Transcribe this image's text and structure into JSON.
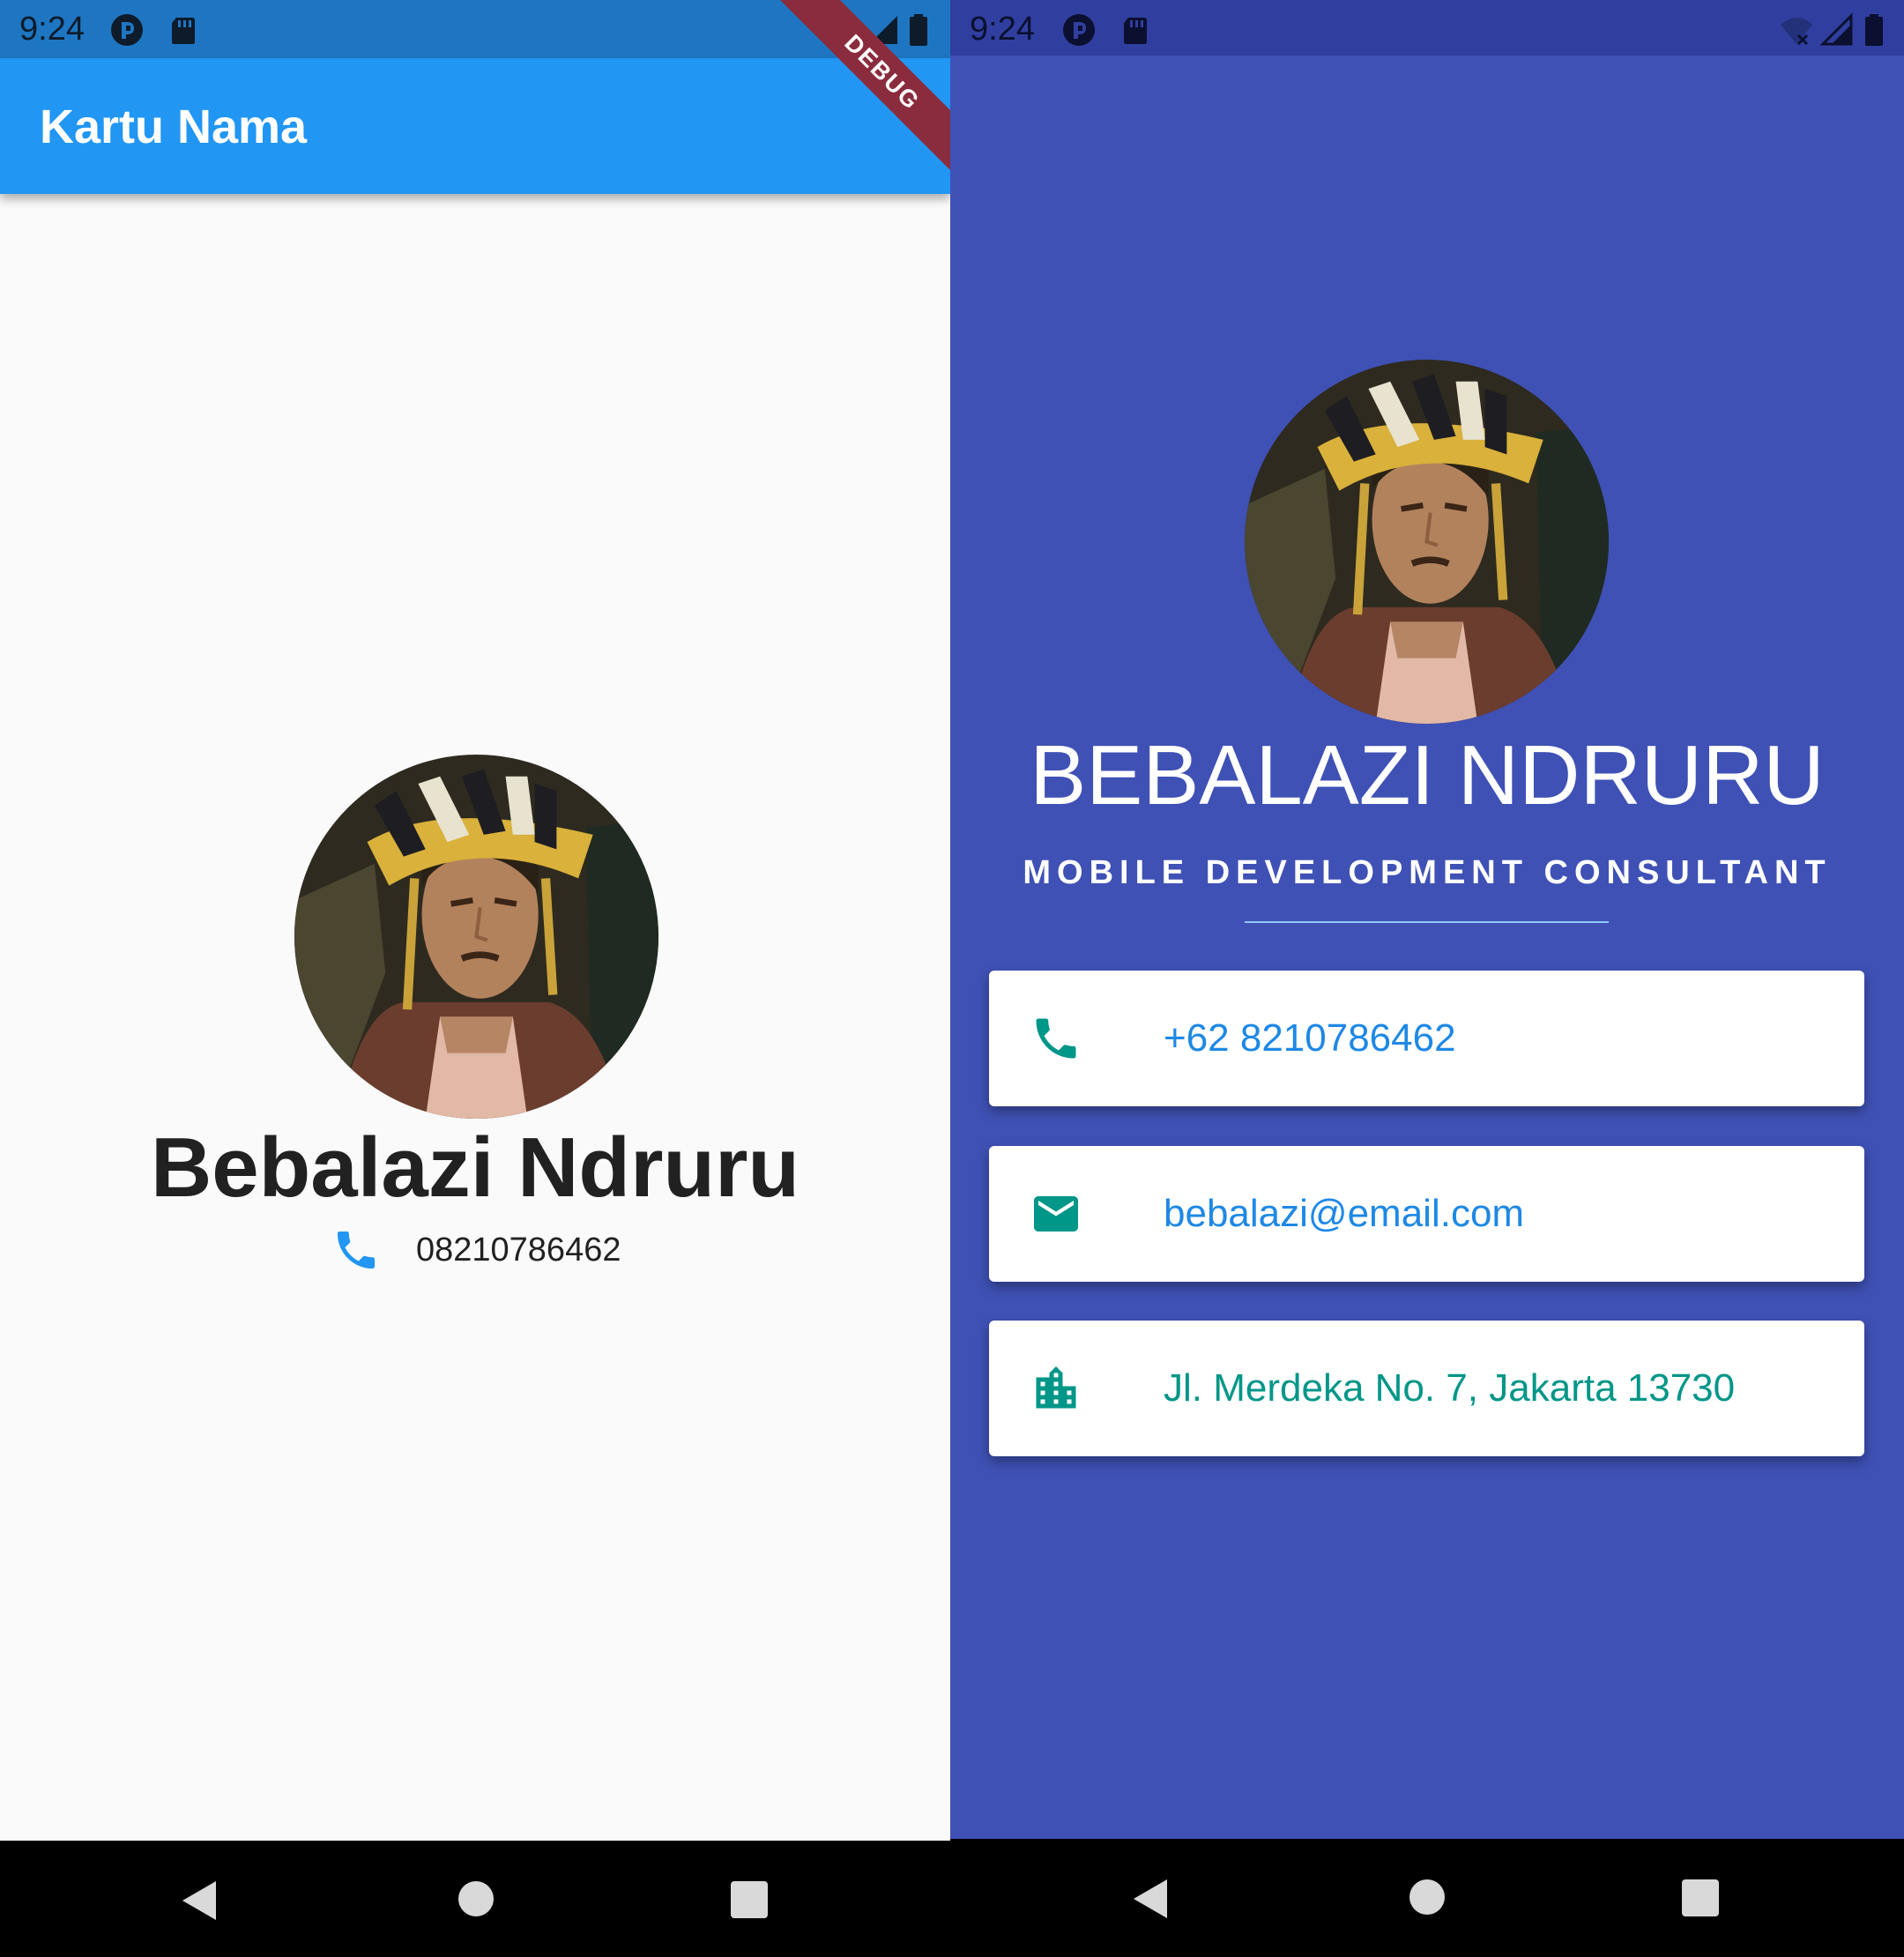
{
  "left_screen": {
    "status_bar": {
      "time": "9:24",
      "background": "#1E76C2",
      "color": "#0d1b2a"
    },
    "app_bar": {
      "title": "Kartu Nama",
      "color": "#2196F3"
    },
    "debug_banner": "DEBUG",
    "profile": {
      "name": "Bebalazi Ndruru",
      "phone": "08210786462",
      "avatar_icon": "profile-photo",
      "phone_icon": "phone-icon",
      "accent": "#2196F3"
    }
  },
  "right_screen": {
    "status_bar": {
      "time": "9:24",
      "background": "#303F9F"
    },
    "background": "#3F51B5",
    "profile": {
      "name": "BEBALAZI NDRURU",
      "title": "MOBILE DEVELOPMENT CONSULTANT"
    },
    "cards": [
      {
        "icon": "phone-icon",
        "text": "+62 8210786462",
        "text_color": "#1E88E5"
      },
      {
        "icon": "mail-icon",
        "text": "bebalazi@email.com",
        "text_color": "#1E88E5"
      },
      {
        "icon": "business-icon",
        "text": "Jl. Merdeka No. 7, Jakarta 13730",
        "text_color": "#009688"
      }
    ],
    "icon_color": "#009688"
  },
  "nav_bar": {
    "buttons": [
      "back-icon",
      "home-icon",
      "recents-icon"
    ]
  }
}
